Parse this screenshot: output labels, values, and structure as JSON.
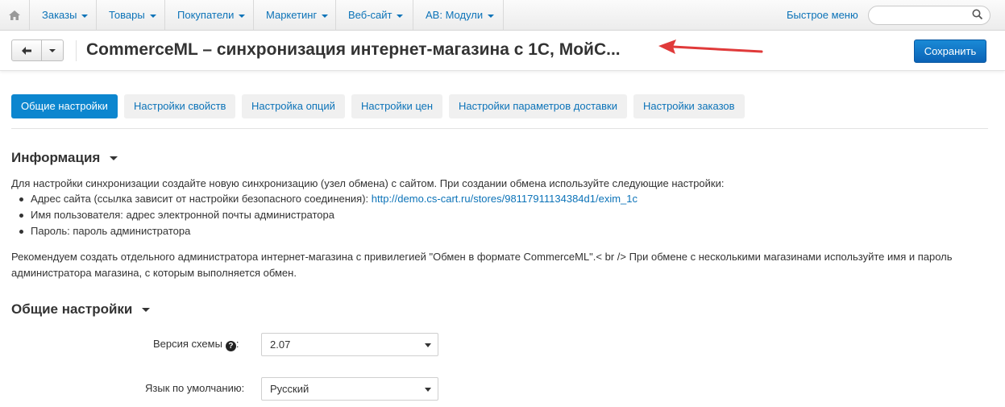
{
  "nav": {
    "items": [
      {
        "label": "Заказы"
      },
      {
        "label": "Товары"
      },
      {
        "label": "Покупатели"
      },
      {
        "label": "Маркетинг"
      },
      {
        "label": "Веб-сайт"
      },
      {
        "label": "AB: Модули"
      }
    ],
    "quick_menu": "Быстрое меню",
    "search_placeholder": ""
  },
  "header": {
    "title": "CommerceML – синхронизация интернет-магазина с 1С, МойС...",
    "save_label": "Сохранить"
  },
  "tabs": [
    {
      "label": "Общие настройки",
      "active": true
    },
    {
      "label": "Настройки свойств"
    },
    {
      "label": "Настройка опций"
    },
    {
      "label": "Настройки цен"
    },
    {
      "label": "Настройки параметров доставки"
    },
    {
      "label": "Настройки заказов"
    }
  ],
  "info": {
    "heading": "Информация",
    "intro": "Для настройки синхронизации создайте новую синхронизацию (узел обмена) с сайтом. При создании обмена используйте следующие настройки:",
    "bullet1_prefix": "Адрес сайта (ссылка зависит от настройки безопасного соединения): ",
    "bullet1_link": "http://demo.cs-cart.ru/stores/98117911134384d1/exim_1c",
    "bullet2": "Имя пользователя: адрес электронной почты администратора",
    "bullet3": "Пароль: пароль администратора",
    "recommend_line1": "Рекомендуем создать отдельного администратора интернет-магазина с привилегией \"Обмен в формате CommerceML\".< br /> При обмене с несколькими магазинами используйте имя и пароль",
    "recommend_line2": "администратора магазина, с которым выполняется обмен."
  },
  "general": {
    "heading": "Общие настройки",
    "schema_label": "Версия схемы",
    "schema_value": "2.07",
    "lang_label": "Язык по умолчанию:",
    "lang_value": "Русский"
  },
  "colors": {
    "link": "#0c73b8",
    "primary_button": "#0b63b6",
    "active_tab": "#0c86cf",
    "annotation_arrow": "#e03a3a"
  }
}
